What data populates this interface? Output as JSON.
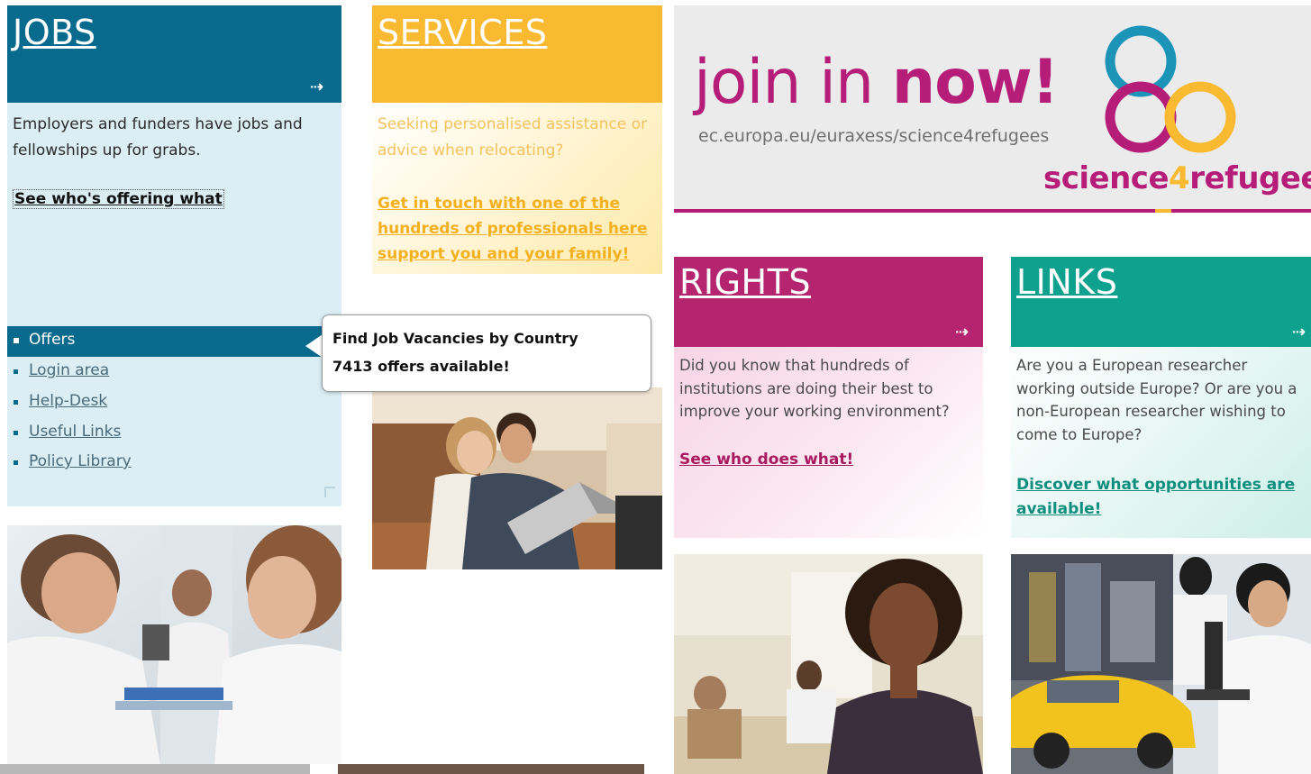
{
  "jobs": {
    "title": "JOBS",
    "description": "Employers and funders have jobs and fellowships up for grabs.",
    "link": "See who's offering what",
    "menu": [
      {
        "label": "Offers"
      },
      {
        "label": "Login area"
      },
      {
        "label": "Help-Desk"
      },
      {
        "label": "Useful Links"
      },
      {
        "label": "Policy Library"
      }
    ]
  },
  "services": {
    "title": "SERVICES",
    "description_line1": "Seeking personalised assistance or",
    "description_line2": "advice when relocating?",
    "link_line1": "Get in touch with one of the",
    "link_line2": "hundreds of professionals here",
    "link_line3": "support you and your family!"
  },
  "tooltip": {
    "line1": "Find Job Vacancies by Country",
    "line2": "7413 offers available!"
  },
  "banner": {
    "join_light": "join in ",
    "join_bold": "now!",
    "url": "ec.europa.eu/euraxess/science4refugees",
    "brand_part1": "science",
    "brand_part2": "4",
    "brand_part3": "refugees"
  },
  "rights": {
    "title": "RIGHTS",
    "description": "Did you know that hundreds of institutions are doing their best to improve your working environment?",
    "link": "See who does what!"
  },
  "links": {
    "title": "LINKS",
    "line1": "Are you a European researcher",
    "line2": "working outside Europe? Or are you a",
    "line3": "non-European researcher wishing to",
    "line4": "come to Europe?",
    "link": "Discover what opportunities are available!"
  },
  "colors": {
    "jobs": "#086a8c",
    "services": "#f9b931",
    "rights": "#b5256f",
    "links": "#0ea18e"
  }
}
